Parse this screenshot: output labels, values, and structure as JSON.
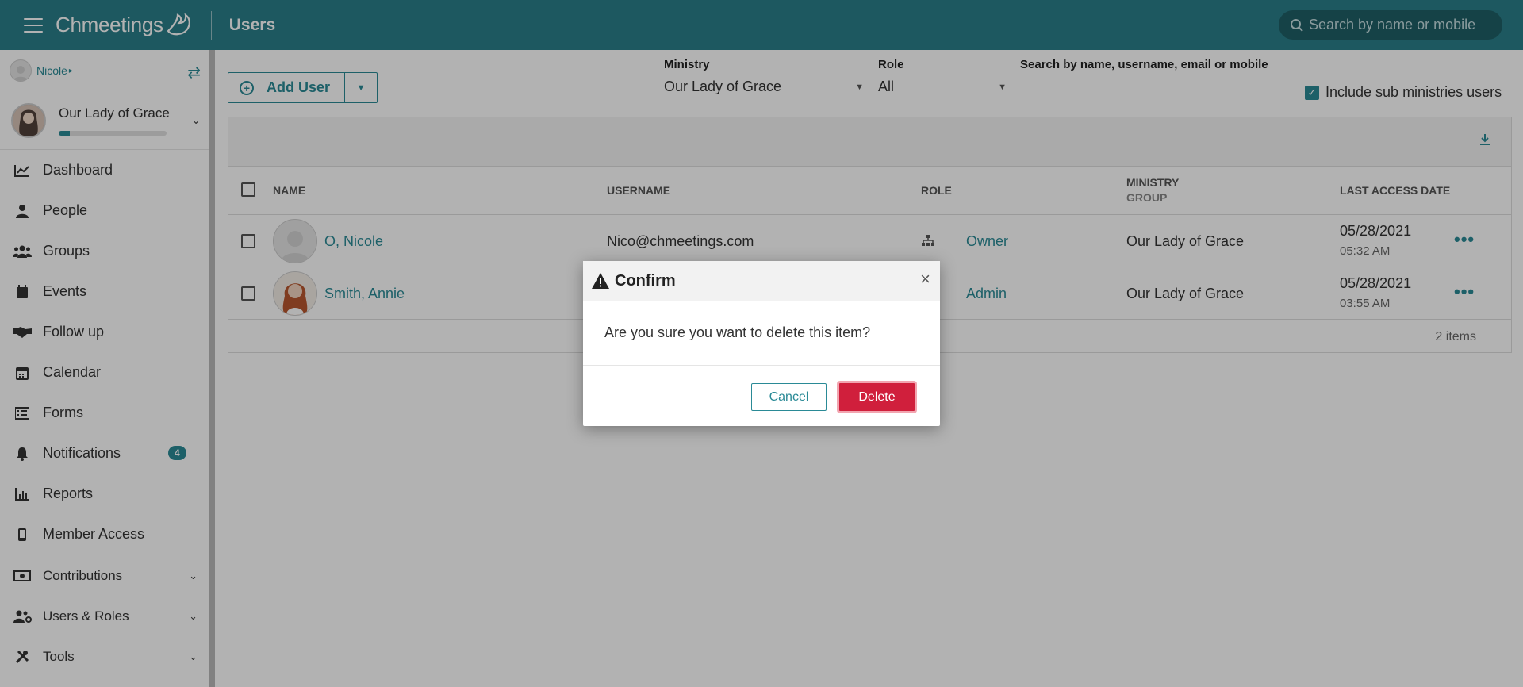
{
  "topbar": {
    "brand": "Chmeetings",
    "page_title": "Users",
    "search_placeholder": "Search by name or mobile"
  },
  "sidebar": {
    "user_name": "Nicole",
    "ministry_name": "Our Lady of Grace",
    "ministry_progress": 0.1,
    "items": [
      {
        "label": "Dashboard",
        "icon": "chart-line-icon"
      },
      {
        "label": "People",
        "icon": "person-icon"
      },
      {
        "label": "Groups",
        "icon": "users-icon"
      },
      {
        "label": "Events",
        "icon": "calendar-event-icon"
      },
      {
        "label": "Follow up",
        "icon": "handshake-icon"
      },
      {
        "label": "Calendar",
        "icon": "calendar-icon"
      },
      {
        "label": "Forms",
        "icon": "list-icon"
      },
      {
        "label": "Notifications",
        "icon": "bell-icon",
        "badge": "4"
      },
      {
        "label": "Reports",
        "icon": "bar-chart-icon"
      },
      {
        "label": "Member Access",
        "icon": "mobile-icon"
      }
    ],
    "expandable": [
      {
        "label": "Contributions",
        "icon": "money-icon"
      },
      {
        "label": "Users & Roles",
        "icon": "users-cog-icon"
      },
      {
        "label": "Tools",
        "icon": "tools-icon"
      }
    ]
  },
  "toolbar": {
    "add_user_label": "Add User",
    "ministry_filter_label": "Ministry",
    "ministry_filter_value": "Our Lady of Grace",
    "role_filter_label": "Role",
    "role_filter_value": "All",
    "search_label": "Search by name, username, email or mobile",
    "search_value": "",
    "include_sub_label": "Include sub ministries users"
  },
  "table": {
    "columns": {
      "name": "NAME",
      "username": "USERNAME",
      "role": "ROLE",
      "ministry": "MINISTRY",
      "group": "GROUP",
      "last_access": "LAST ACCESS DATE"
    },
    "rows": [
      {
        "name": "O, Nicole",
        "username": "Nico@chmeetings.com",
        "role": "Owner",
        "ministry": "Our Lady of Grace",
        "date": "05/28/2021",
        "time": "05:32 AM"
      },
      {
        "name": "Smith, Annie",
        "username": "",
        "role": "Admin",
        "ministry": "Our Lady of Grace",
        "date": "05/28/2021",
        "time": "03:55 AM"
      }
    ],
    "footer_count": "2 items"
  },
  "dialog": {
    "title": "Confirm",
    "message": "Are you sure you want to delete this item?",
    "cancel_label": "Cancel",
    "delete_label": "Delete"
  },
  "colors": {
    "accent": "#2a7f8a",
    "danger": "#d01f3c"
  }
}
